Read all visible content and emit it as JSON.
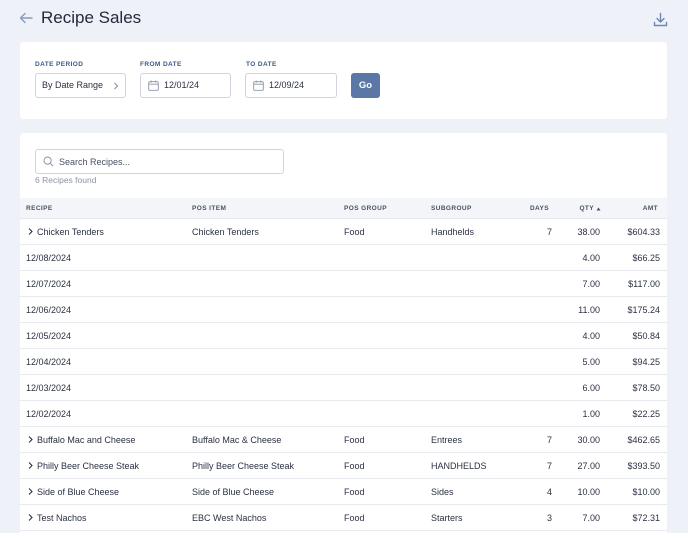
{
  "header": {
    "title": "Recipe Sales"
  },
  "filters": {
    "date_period_label": "DATE PERIOD",
    "date_period_value": "By Date Range",
    "from_label": "FROM DATE",
    "from_value": "12/01/24",
    "to_label": "TO DATE",
    "to_value": "12/09/24",
    "go_label": "Go"
  },
  "search": {
    "placeholder": "Search Recipes...",
    "value": ""
  },
  "found_text": "6 Recipes found",
  "columns": {
    "recipe": "RECIPE",
    "pos_item": "POS ITEM",
    "pos_group": "POS GROUP",
    "subgroup": "SUBGROUP",
    "days": "DAYS",
    "qty": "QTY",
    "amt": "AMT"
  },
  "rows": [
    {
      "type": "recipe",
      "recipe": "Chicken Tenders",
      "pos_item": "Chicken Tenders",
      "pos_group": "Food",
      "subgroup": "Handhelds",
      "days": "7",
      "qty": "38.00",
      "amt": "$604.33"
    },
    {
      "type": "date",
      "recipe": "12/08/2024",
      "qty": "4.00",
      "amt": "$66.25"
    },
    {
      "type": "date",
      "recipe": "12/07/2024",
      "qty": "7.00",
      "amt": "$117.00"
    },
    {
      "type": "date",
      "recipe": "12/06/2024",
      "qty": "11.00",
      "amt": "$175.24"
    },
    {
      "type": "date",
      "recipe": "12/05/2024",
      "qty": "4.00",
      "amt": "$50.84"
    },
    {
      "type": "date",
      "recipe": "12/04/2024",
      "qty": "5.00",
      "amt": "$94.25"
    },
    {
      "type": "date",
      "recipe": "12/03/2024",
      "qty": "6.00",
      "amt": "$78.50"
    },
    {
      "type": "date",
      "recipe": "12/02/2024",
      "qty": "1.00",
      "amt": "$22.25"
    },
    {
      "type": "recipe",
      "recipe": "Buffalo Mac and Cheese",
      "pos_item": "Buffalo Mac & Cheese",
      "pos_group": "Food",
      "subgroup": "Entrees",
      "days": "7",
      "qty": "30.00",
      "amt": "$462.65"
    },
    {
      "type": "recipe",
      "recipe": "Philly Beer Cheese Steak",
      "pos_item": "Philly Beer Cheese Steak",
      "pos_group": "Food",
      "subgroup": "HANDHELDS",
      "days": "7",
      "qty": "27.00",
      "amt": "$393.50"
    },
    {
      "type": "recipe",
      "recipe": "Side of Blue Cheese",
      "pos_item": "Side of Blue Cheese",
      "pos_group": "Food",
      "subgroup": "Sides",
      "days": "4",
      "qty": "10.00",
      "amt": "$10.00"
    },
    {
      "type": "recipe",
      "recipe": "Test Nachos",
      "pos_item": "EBC West Nachos",
      "pos_group": "Food",
      "subgroup": "Starters",
      "days": "3",
      "qty": "7.00",
      "amt": "$72.31"
    }
  ],
  "colors": {
    "accent": "#5b77a5",
    "label": "#3b5a87",
    "background": "#eef1f8"
  }
}
